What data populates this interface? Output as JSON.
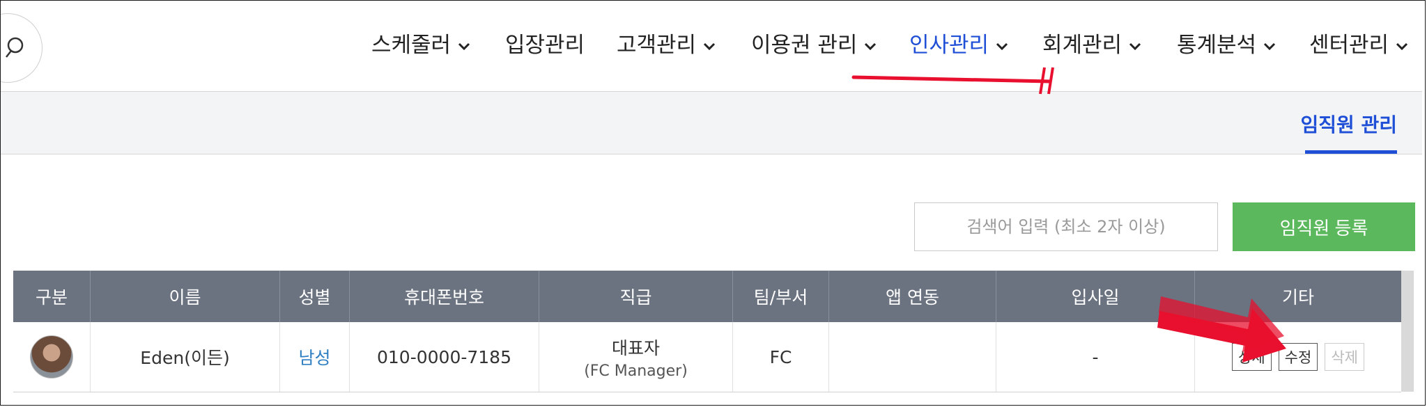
{
  "nav": {
    "items": [
      {
        "label": "스케줄러",
        "has_dropdown": true,
        "active": false
      },
      {
        "label": "입장관리",
        "has_dropdown": false,
        "active": false
      },
      {
        "label": "고객관리",
        "has_dropdown": true,
        "active": false
      },
      {
        "label": "이용권 관리",
        "has_dropdown": true,
        "active": false
      },
      {
        "label": "인사관리",
        "has_dropdown": true,
        "active": true
      },
      {
        "label": "회계관리",
        "has_dropdown": true,
        "active": false
      },
      {
        "label": "통계분석",
        "has_dropdown": true,
        "active": false
      },
      {
        "label": "센터관리",
        "has_dropdown": true,
        "active": false
      }
    ]
  },
  "subnav": {
    "active_tab": "임직원 관리"
  },
  "toolbar": {
    "search_placeholder": "검색어 입력 (최소 2자 이상)",
    "register_label": "임직원 등록"
  },
  "table": {
    "headers": [
      "구분",
      "이름",
      "성별",
      "휴대폰번호",
      "직급",
      "팀/부서",
      "앱 연동",
      "입사일",
      "기타"
    ],
    "rows": [
      {
        "name": "Eden(이든)",
        "gender": "남성",
        "phone": "010-0000-7185",
        "rank": "대표자",
        "rank_sub": "(FC Manager)",
        "team": "FC",
        "app_link": "",
        "join_date": "-",
        "actions": [
          "상세",
          "수정",
          "삭제"
        ]
      }
    ]
  },
  "colors": {
    "accent": "#1f4fd6",
    "annotation": "#e8102e",
    "register": "#5cb85c",
    "table_header": "#6b7280"
  }
}
